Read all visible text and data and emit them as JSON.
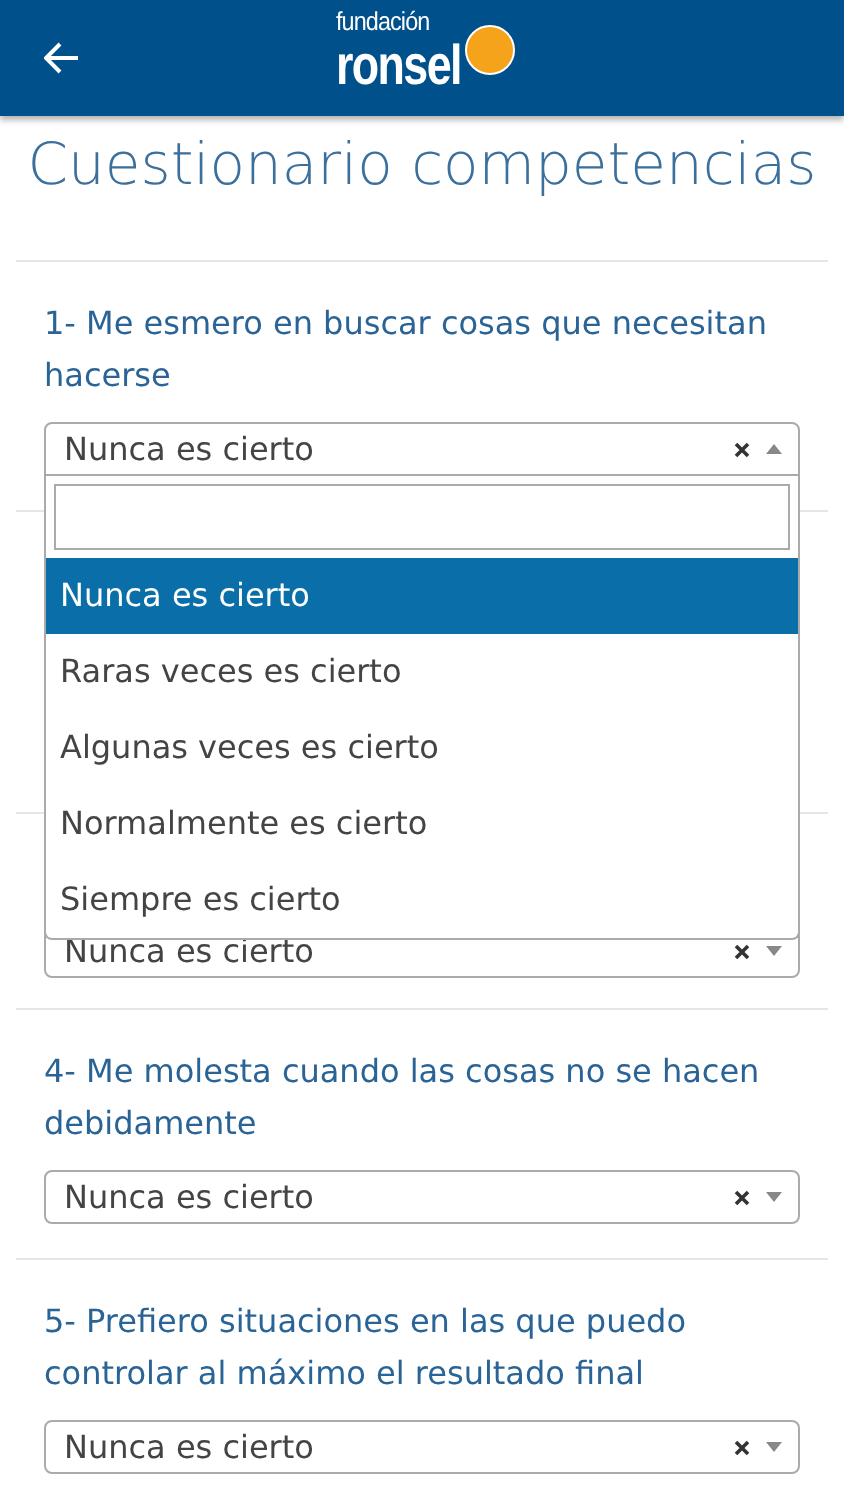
{
  "header": {
    "logo_top": "fundación",
    "logo_bottom": "ronsel"
  },
  "title": "Cuestionario competencias",
  "questions": [
    {
      "label": "1- Me esmero en buscar cosas que necesitan hacerse",
      "value": "Nunca es cierto",
      "expanded": true,
      "options": [
        {
          "label": "Nunca es cierto",
          "selected": true
        },
        {
          "label": "Raras veces es cierto",
          "selected": false
        },
        {
          "label": "Algunas veces es cierto",
          "selected": false
        },
        {
          "label": "Normalmente es cierto",
          "selected": false
        },
        {
          "label": "Siempre es cierto",
          "selected": false
        }
      ]
    },
    {
      "value": "Nunca es cierto",
      "expanded": false
    },
    {
      "label": "4- Me molesta cuando las cosas no se hacen debidamente",
      "value": "Nunca es cierto",
      "expanded": false
    },
    {
      "label": "5- Prefiero situaciones en las que puedo controlar al máximo el resultado final",
      "value": "Nunca es cierto",
      "expanded": false
    }
  ]
}
